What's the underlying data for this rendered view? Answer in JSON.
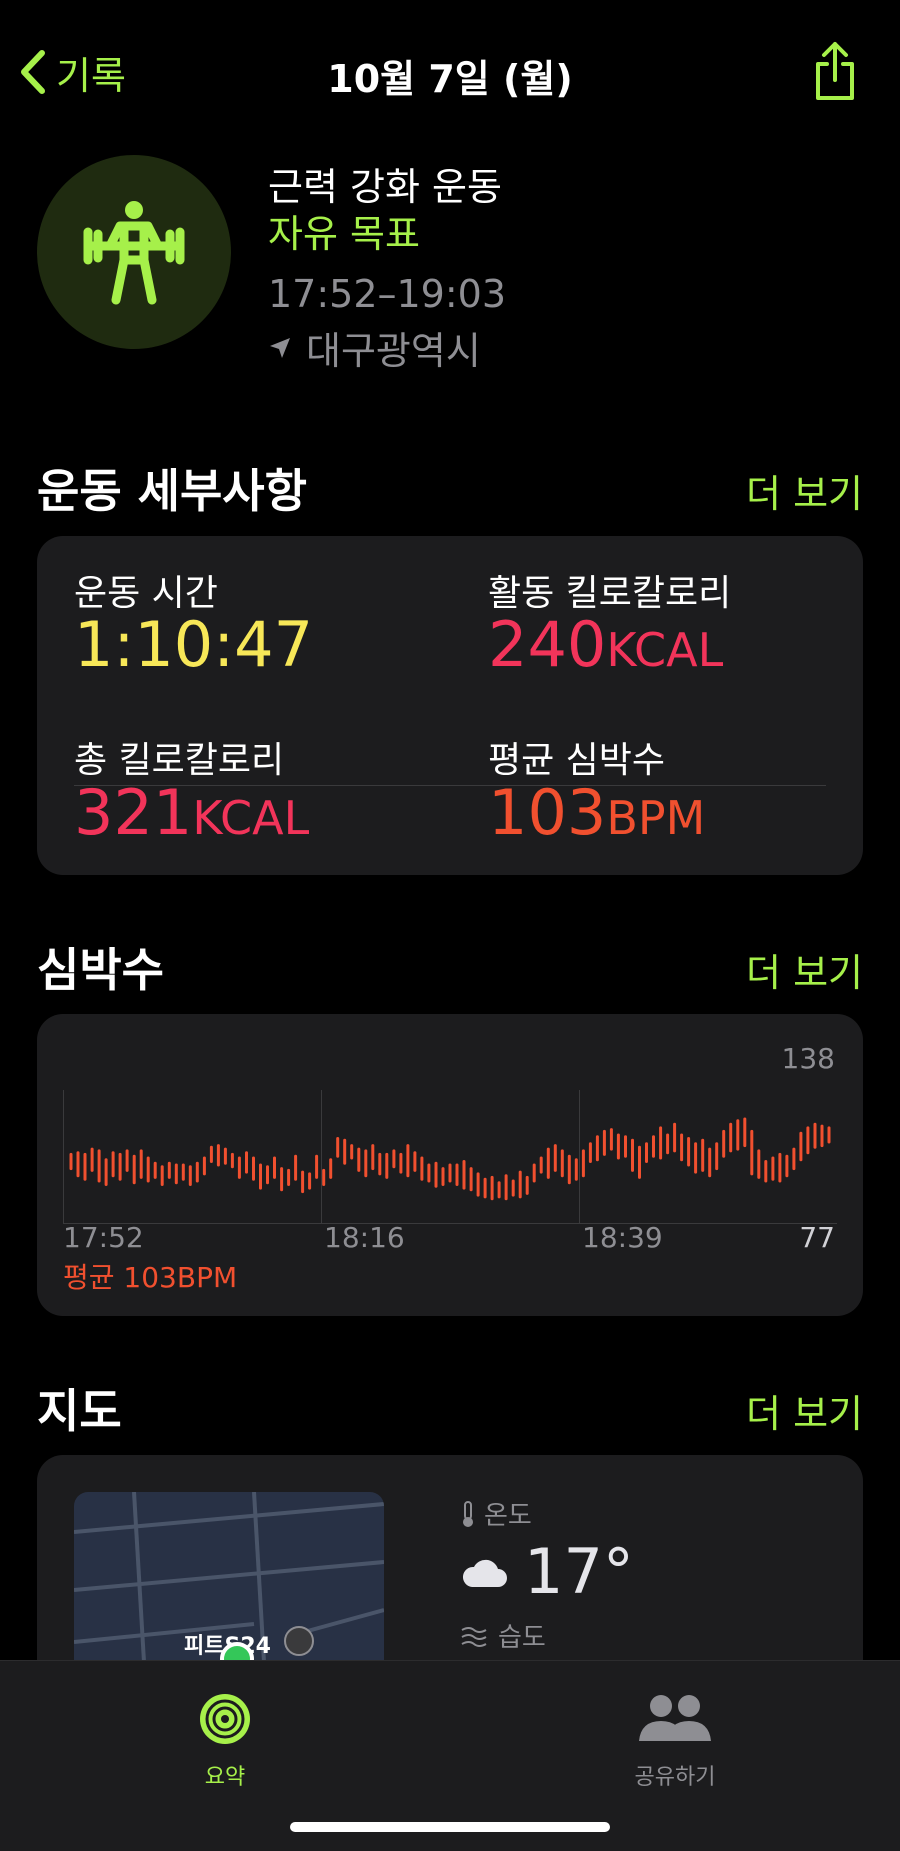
{
  "nav": {
    "back_label": "기록",
    "title": "10월 7일 (월)"
  },
  "workout": {
    "icon": "strength-training-icon",
    "name": "근력 강화 운동",
    "goal": "자유 목표",
    "time_range": "17:52–19:03",
    "location": "대구광역시"
  },
  "details": {
    "title": "운동 세부사항",
    "more_label": "더 보기",
    "metrics": [
      {
        "label": "운동 시간",
        "value": "1:10:47",
        "unit": ""
      },
      {
        "label": "활동 킬로칼로리",
        "value": "240",
        "unit": "KCAL"
      },
      {
        "label": "총 킬로칼로리",
        "value": "321",
        "unit": "KCAL"
      },
      {
        "label": "평균 심박수",
        "value": "103",
        "unit": "BPM"
      }
    ]
  },
  "heart_rate": {
    "title": "심박수",
    "more_label": "더 보기",
    "max_label": "138",
    "min_label": "77",
    "time_labels": [
      "17:52",
      "18:16",
      "18:39"
    ],
    "avg_label": "평균 103BPM"
  },
  "chart_data": {
    "type": "bar",
    "title": "",
    "ylim": [
      77,
      138
    ],
    "ranges": [
      [
        97,
        105
      ],
      [
        93,
        106
      ],
      [
        91,
        105
      ],
      [
        96,
        108
      ],
      [
        90,
        107
      ],
      [
        88,
        102
      ],
      [
        93,
        106
      ],
      [
        91,
        105
      ],
      [
        96,
        107
      ],
      [
        89,
        104
      ],
      [
        92,
        107
      ],
      [
        90,
        103
      ],
      [
        92,
        100
      ],
      [
        88,
        98
      ],
      [
        92,
        100
      ],
      [
        89,
        99
      ],
      [
        91,
        99
      ],
      [
        88,
        98
      ],
      [
        90,
        100
      ],
      [
        94,
        103
      ],
      [
        101,
        109
      ],
      [
        99,
        110
      ],
      [
        100,
        108
      ],
      [
        98,
        105
      ],
      [
        92,
        103
      ],
      [
        95,
        106
      ],
      [
        91,
        103
      ],
      [
        86,
        99
      ],
      [
        89,
        98
      ],
      [
        92,
        103
      ],
      [
        85,
        97
      ],
      [
        88,
        96
      ],
      [
        91,
        104
      ],
      [
        84,
        95
      ],
      [
        86,
        94
      ],
      [
        92,
        104
      ],
      [
        88,
        96
      ],
      [
        92,
        102
      ],
      [
        104,
        114
      ],
      [
        100,
        113
      ],
      [
        103,
        110
      ],
      [
        96,
        108
      ],
      [
        93,
        107
      ],
      [
        97,
        110
      ],
      [
        94,
        105
      ],
      [
        92,
        105
      ],
      [
        98,
        107
      ],
      [
        95,
        105
      ],
      [
        93,
        110
      ],
      [
        96,
        106
      ],
      [
        91,
        103
      ],
      [
        90,
        99
      ],
      [
        87,
        100
      ],
      [
        88,
        97
      ],
      [
        90,
        99
      ],
      [
        88,
        99
      ],
      [
        86,
        101
      ],
      [
        85,
        97
      ],
      [
        82,
        94
      ],
      [
        81,
        91
      ],
      [
        80,
        92
      ],
      [
        81,
        89
      ],
      [
        80,
        93
      ],
      [
        82,
        90
      ],
      [
        81,
        95
      ],
      [
        83,
        92
      ],
      [
        90,
        99
      ],
      [
        95,
        103
      ],
      [
        92,
        108
      ],
      [
        96,
        110
      ],
      [
        93,
        107
      ],
      [
        89,
        104
      ],
      [
        91,
        102
      ],
      [
        93,
        107
      ],
      [
        101,
        111
      ],
      [
        102,
        115
      ],
      [
        105,
        118
      ],
      [
        108,
        119
      ],
      [
        103,
        116
      ],
      [
        104,
        115
      ],
      [
        96,
        113
      ],
      [
        92,
        109
      ],
      [
        101,
        111
      ],
      [
        104,
        115
      ],
      [
        103,
        120
      ],
      [
        106,
        116
      ],
      [
        107,
        122
      ],
      [
        102,
        116
      ],
      [
        99,
        114
      ],
      [
        95,
        111
      ],
      [
        96,
        113
      ],
      [
        93,
        108
      ],
      [
        97,
        111
      ],
      [
        104,
        118
      ],
      [
        107,
        122
      ],
      [
        108,
        124
      ],
      [
        110,
        125
      ],
      [
        94,
        118
      ],
      [
        92,
        107
      ],
      [
        90,
        101
      ],
      [
        91,
        103
      ],
      [
        90,
        105
      ],
      [
        93,
        104
      ],
      [
        97,
        108
      ],
      [
        102,
        117
      ],
      [
        106,
        120
      ],
      [
        109,
        122
      ],
      [
        110,
        121
      ],
      [
        112,
        120
      ]
    ],
    "x_labels": [
      "17:52",
      "18:16",
      "18:39"
    ],
    "annotations": [
      "138",
      "77",
      "평균 103BPM"
    ]
  },
  "map": {
    "title": "지도",
    "more_label": "더 보기",
    "map_label": "피트S24",
    "temperature_label": "온도",
    "temperature_value": "17°",
    "humidity_label": "습도"
  },
  "tabs": [
    {
      "label": "요약",
      "icon": "activity-rings-icon",
      "active": true
    },
    {
      "label": "공유하기",
      "icon": "people-icon",
      "active": false
    }
  ],
  "colors": {
    "accent": "#a6f04a",
    "duration": "#f7e758",
    "calories": "#f2345a",
    "heart": "#f1502f",
    "card": "#1c1c1e"
  }
}
